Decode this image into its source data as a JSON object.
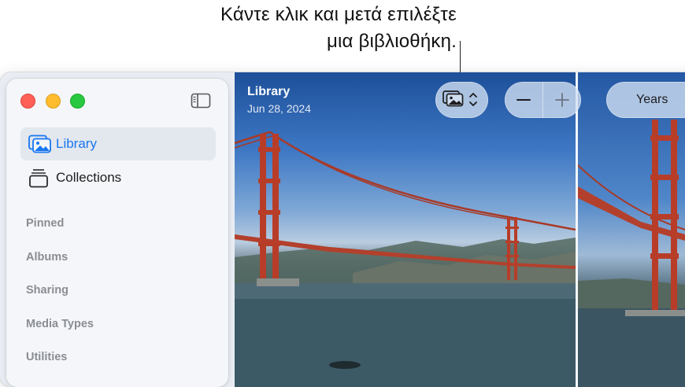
{
  "callout": {
    "line1": "Κάντε κλικ και μετά επιλέξτε",
    "line2": "μια βιβλιοθήκη."
  },
  "sidebar": {
    "items": [
      {
        "label": "Library",
        "icon": "photo-library-icon",
        "selected": true
      },
      {
        "label": "Collections",
        "icon": "stack-icon",
        "selected": false
      }
    ],
    "sections": [
      "Pinned",
      "Albums",
      "Sharing",
      "Media Types",
      "Utilities"
    ]
  },
  "photo": {
    "title": "Library",
    "date": "Jun 28, 2024"
  },
  "toolbar": {
    "library_picker_icon": "photo-library-icon",
    "zoom_out_icon": "minus-icon",
    "zoom_in_icon": "plus-icon",
    "view_label": "Years"
  },
  "colors": {
    "accent": "#1877f2",
    "close": "#fe5f57",
    "minimize": "#febc2e",
    "zoom": "#28c840"
  }
}
